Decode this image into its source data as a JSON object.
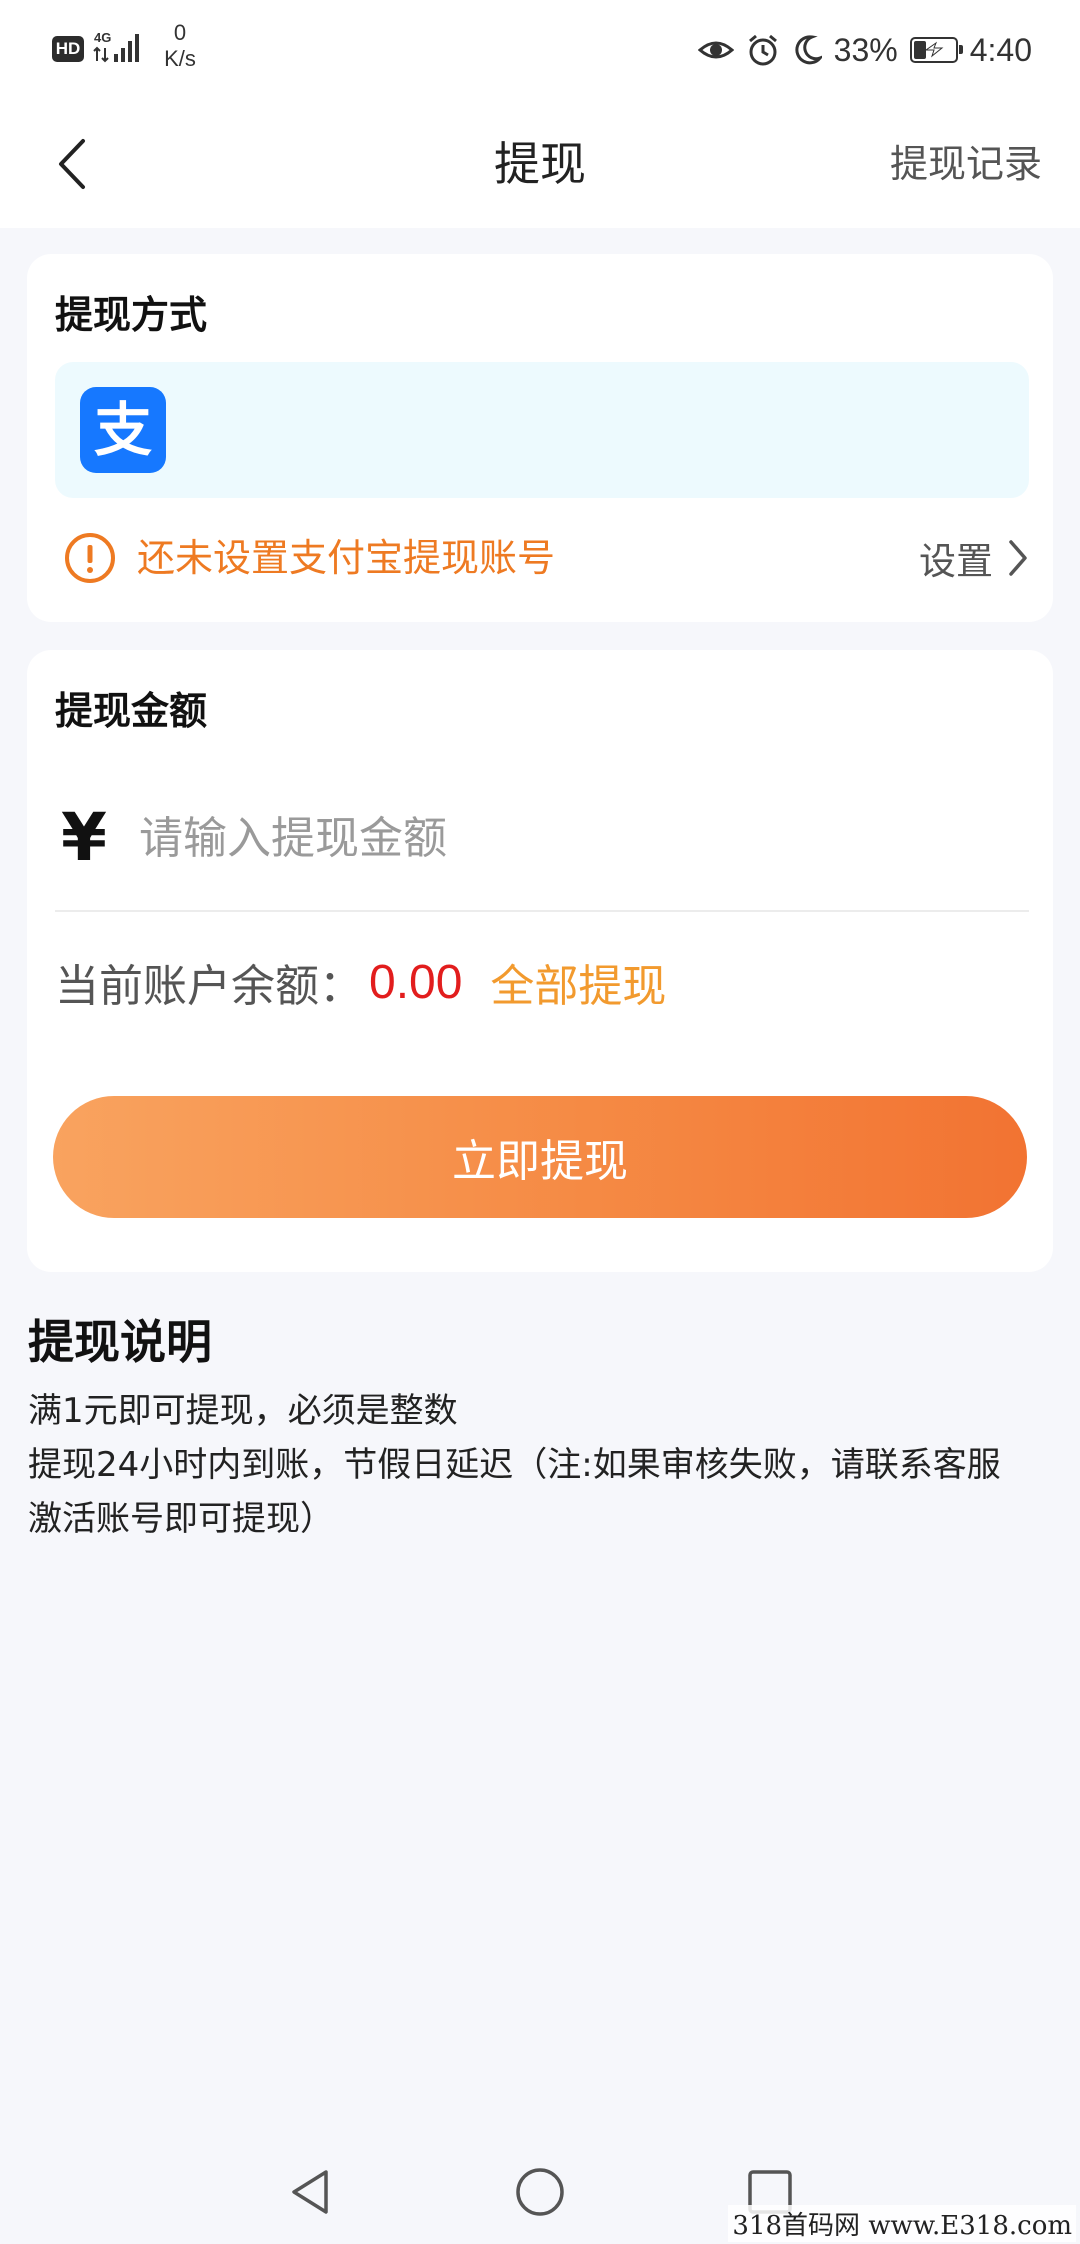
{
  "status_bar": {
    "hd_badge": "HD",
    "network_type": "4G",
    "net_speed_value": "0",
    "net_speed_unit": "K/s",
    "battery_percent": "33%",
    "battery_level": 0.33,
    "time": "4:40",
    "icons": [
      "eye-icon",
      "alarm-icon",
      "moon-icon",
      "battery-charging-icon"
    ]
  },
  "header": {
    "title": "提现",
    "right_link": "提现记录",
    "back_icon": "chevron-left-icon"
  },
  "method_card": {
    "title": "提现方式",
    "option": {
      "logo_text": "支",
      "logo_color": "#1678ff"
    },
    "warning": {
      "text": "还未设置支付宝提现账号",
      "color": "#ee7a22"
    },
    "setup_label": "设置"
  },
  "amount_card": {
    "title": "提现金额",
    "currency_symbol": "¥",
    "input_value": "",
    "input_placeholder": "请输入提现金额",
    "balance_label": "当前账户余额：",
    "balance_value": "0.00",
    "withdraw_all_label": "全部提现",
    "submit_label": "立即提现"
  },
  "notes": {
    "title": "提现说明",
    "lines": [
      "满1元即可提现，必须是整数",
      "提现24小时内到账，节假日延迟（注:如果审核失败，请联系客服",
      "激活账号即可提现）"
    ]
  },
  "nav_bar": {
    "icons": [
      "triangle-back-icon",
      "circle-home-icon",
      "square-recent-icon"
    ]
  },
  "watermark": "318首码网  www.E318.com",
  "colors": {
    "accent_orange": "#f58a44",
    "warning_orange": "#ee7a22",
    "balance_red": "#e21d1d",
    "withdraw_all_orange": "#f29a2e",
    "page_background": "#f6f7fb"
  }
}
